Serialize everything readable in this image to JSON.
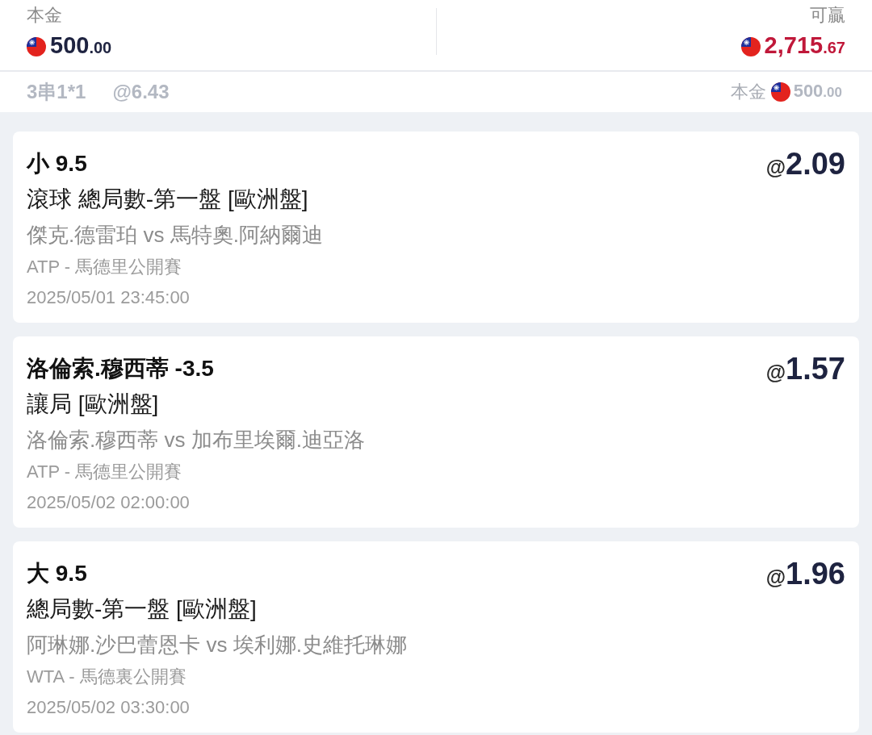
{
  "totals": {
    "stake": {
      "label": "本金",
      "whole": "500",
      "fraction": ".00"
    },
    "payout": {
      "label": "可贏",
      "whole": "2,715",
      "fraction": ".67"
    }
  },
  "summary": {
    "combo": "3串1*1",
    "total_odds": "@6.43",
    "stake_label": "本金",
    "stake_whole": "500",
    "stake_fraction": ".00"
  },
  "bets": [
    {
      "selection": "小 9.5",
      "market": "滾球 總局數-第一盤 [歐洲盤]",
      "match": "傑克.德雷珀 vs 馬特奧.阿納爾迪",
      "league": "ATP - 馬德里公開賽",
      "time": "2025/05/01 23:45:00",
      "odds_symbol": "@",
      "odds": "2.09"
    },
    {
      "selection": "洛倫索.穆西蒂 -3.5",
      "market": "讓局 [歐洲盤]",
      "match": "洛倫索.穆西蒂 vs 加布里埃爾.迪亞洛",
      "league": "ATP - 馬德里公開賽",
      "time": "2025/05/02 02:00:00",
      "odds_symbol": "@",
      "odds": "1.57"
    },
    {
      "selection": "大 9.5",
      "market": "總局數-第一盤 [歐洲盤]",
      "match": "阿琳娜.沙巴蕾恩卡 vs 埃利娜.史維托琳娜",
      "league": "WTA - 馬德裏公開賽",
      "time": "2025/05/02 03:30:00",
      "odds_symbol": "@",
      "odds": "1.96"
    }
  ]
}
